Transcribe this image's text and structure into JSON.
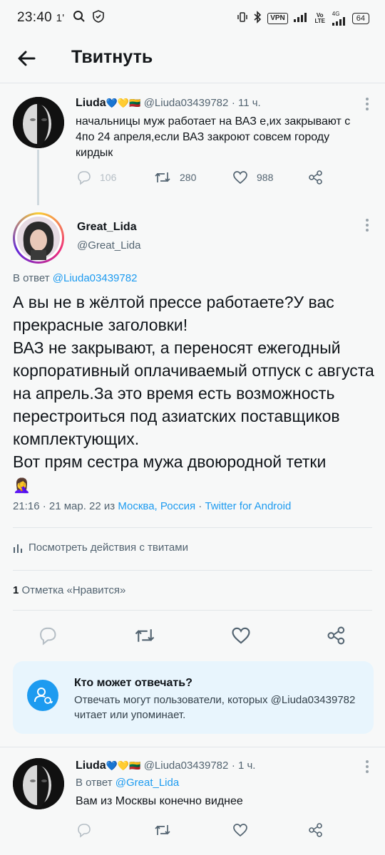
{
  "status_bar": {
    "time": "23:40",
    "time_marker": "1'",
    "vpn": "VPN",
    "volte": "Vo LTE",
    "net": "4G",
    "battery": "64"
  },
  "header": {
    "title": "Твитнуть"
  },
  "parent_tweet": {
    "name": "Liuda",
    "emoji": [
      "💙",
      "💛",
      "🇱🇹"
    ],
    "handle": "@Liuda03439782",
    "time": "· 11 ч.",
    "text": "начальницы муж работает на ВАЗ е,их закрывают с 4по 24 апреля,если ВАЗ закроют совсем городу кирдык",
    "replies": "106",
    "retweets": "280",
    "likes": "988"
  },
  "main_tweet": {
    "name": "Great_Lida",
    "handle": "@Great_Lida",
    "reply_prefix": "В ответ",
    "reply_to": "@Liuda03439782",
    "text": "А вы не в жёлтой прессе работаете?У вас прекрасные заголовки!\nВАЗ не закрывают, а переносят ежегодный корпоративный оплачиваемый отпуск с августа на апрель.За это время есть возможность перестроиться под азиатских поставщиков комплектующих.\nВот прям сестра мужа двоюродной тетки",
    "text_emoji": "🤦‍♀️",
    "time": "21:16 · 21 мар. 22 из",
    "location": "Москва, Россия",
    "dot": "·",
    "source": "Twitter for Android",
    "activity": "Посмотреть действия с твитами",
    "likes_count": "1",
    "likes_label": "Отметка «Нравится»"
  },
  "reply_notice": {
    "title": "Кто может отвечать?",
    "text": "Отвечать могут пользователи, которых @Liuda03439782 читает или упоминает."
  },
  "reply_tweet": {
    "name": "Liuda",
    "emoji": [
      "💙",
      "💛",
      "🇱🇹"
    ],
    "handle": "@Liuda03439782",
    "time": "· 1 ч.",
    "reply_prefix": "В ответ",
    "reply_to": "@Great_Lida",
    "text": "Вам из Москвы конечно виднее"
  },
  "colors": {
    "accent": "#1d9bf0",
    "muted": "#536471",
    "notice_bg": "#e8f5fd"
  }
}
